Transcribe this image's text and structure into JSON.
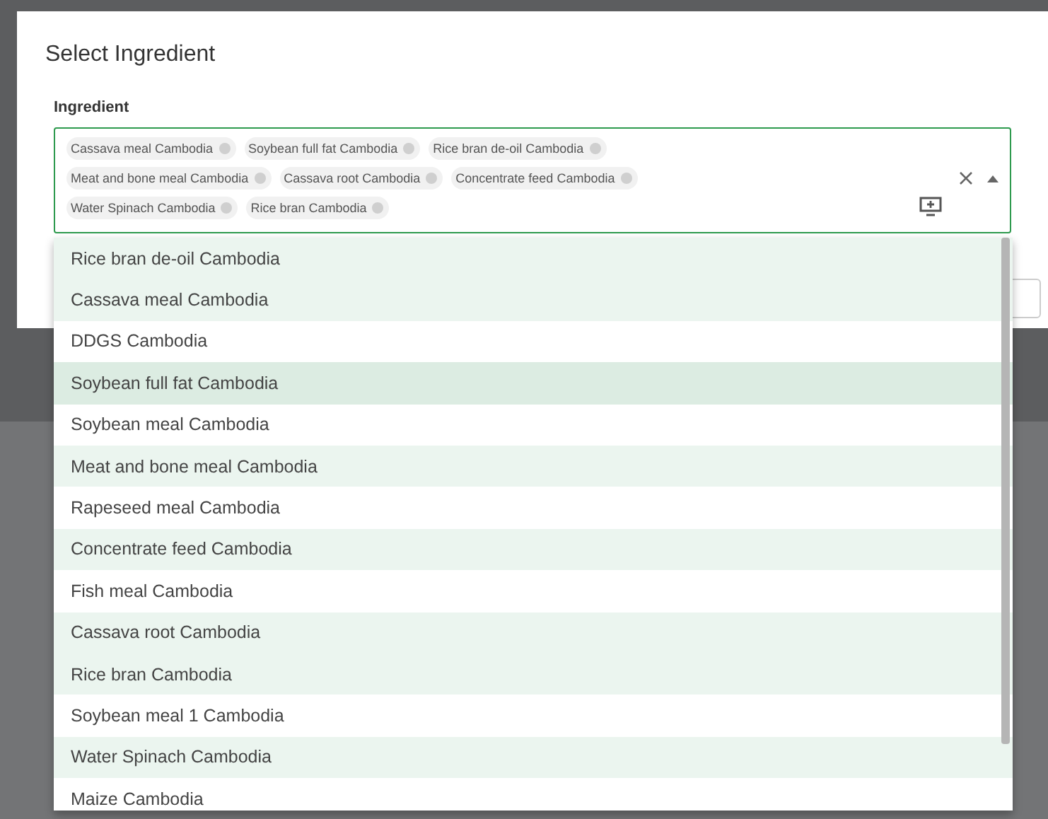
{
  "dialog": {
    "title": "Select Ingredient"
  },
  "field": {
    "label": "Ingredient",
    "chips": [
      {
        "label": "Cassava meal Cambodia"
      },
      {
        "label": "Soybean full fat Cambodia"
      },
      {
        "label": "Rice bran de-oil Cambodia"
      },
      {
        "label": "Meat and bone meal Cambodia"
      },
      {
        "label": "Cassava root Cambodia"
      },
      {
        "label": "Concentrate feed Cambodia"
      },
      {
        "label": "Water Spinach Cambodia"
      },
      {
        "label": "Rice bran Cambodia"
      }
    ]
  },
  "options": [
    {
      "label": "Rice bran de-oil Cambodia",
      "selected": true,
      "highlighted": false
    },
    {
      "label": "Cassava meal Cambodia",
      "selected": true,
      "highlighted": false
    },
    {
      "label": "DDGS Cambodia",
      "selected": false,
      "highlighted": false
    },
    {
      "label": "Soybean full fat Cambodia",
      "selected": true,
      "highlighted": true
    },
    {
      "label": "Soybean meal Cambodia",
      "selected": false,
      "highlighted": false
    },
    {
      "label": "Meat and bone meal Cambodia",
      "selected": true,
      "highlighted": false
    },
    {
      "label": "Rapeseed meal Cambodia",
      "selected": false,
      "highlighted": false
    },
    {
      "label": "Concentrate feed Cambodia",
      "selected": true,
      "highlighted": false
    },
    {
      "label": "Fish meal Cambodia",
      "selected": false,
      "highlighted": false
    },
    {
      "label": "Cassava root Cambodia",
      "selected": true,
      "highlighted": false
    },
    {
      "label": "Rice bran Cambodia",
      "selected": true,
      "highlighted": false
    },
    {
      "label": "Soybean meal 1 Cambodia",
      "selected": false,
      "highlighted": false
    },
    {
      "label": "Water Spinach Cambodia",
      "selected": true,
      "highlighted": false
    },
    {
      "label": "Maize Cambodia",
      "selected": false,
      "highlighted": false
    }
  ]
}
